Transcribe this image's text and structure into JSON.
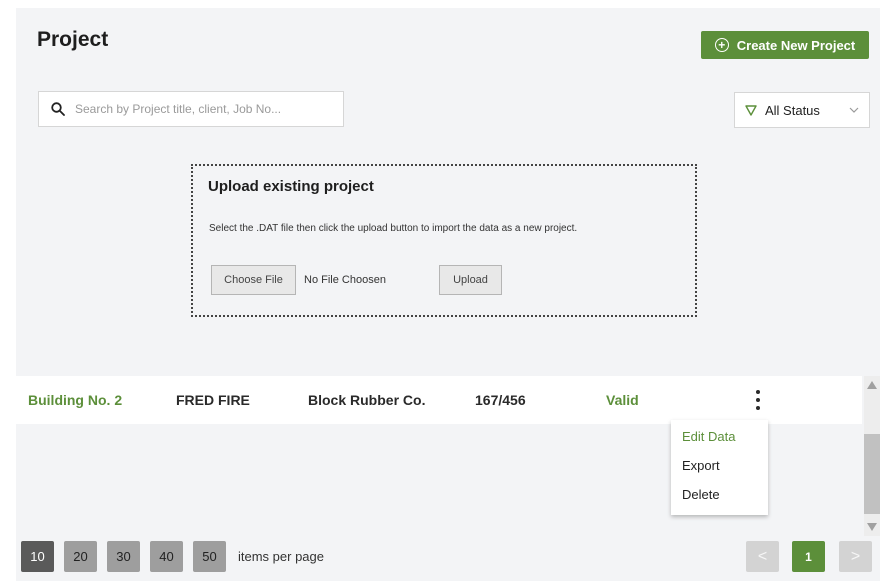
{
  "header": {
    "title": "Project",
    "create_button": "Create New Project"
  },
  "search": {
    "placeholder": "Search by Project title, client, Job No..."
  },
  "status_filter": {
    "selected": "All Status"
  },
  "upload": {
    "title": "Upload existing project",
    "description": "Select the .DAT file then click the upload button to import the data as a new project.",
    "choose_label": "Choose File",
    "file_status": "No File Choosen",
    "upload_label": "Upload"
  },
  "table": {
    "rows": [
      {
        "project": "Building No. 2",
        "contact": "FRED FIRE",
        "client": "Block Rubber Co.",
        "job_no": "167/456",
        "status": "Valid"
      }
    ]
  },
  "row_menu": {
    "items": [
      "Edit Data",
      "Export",
      "Delete"
    ]
  },
  "pagination": {
    "sizes": [
      "10",
      "20",
      "30",
      "40",
      "50"
    ],
    "selected_size": "10",
    "per_page_label": "items per page",
    "current_page": "1",
    "prev": "<",
    "next": ">"
  },
  "colors": {
    "accent": "#5c8f3a",
    "background": "#f3f4f6"
  },
  "icons": [
    "plus-circle-icon",
    "search-icon",
    "filter-icon",
    "chevron-down-icon",
    "kebab-menu-icon"
  ]
}
